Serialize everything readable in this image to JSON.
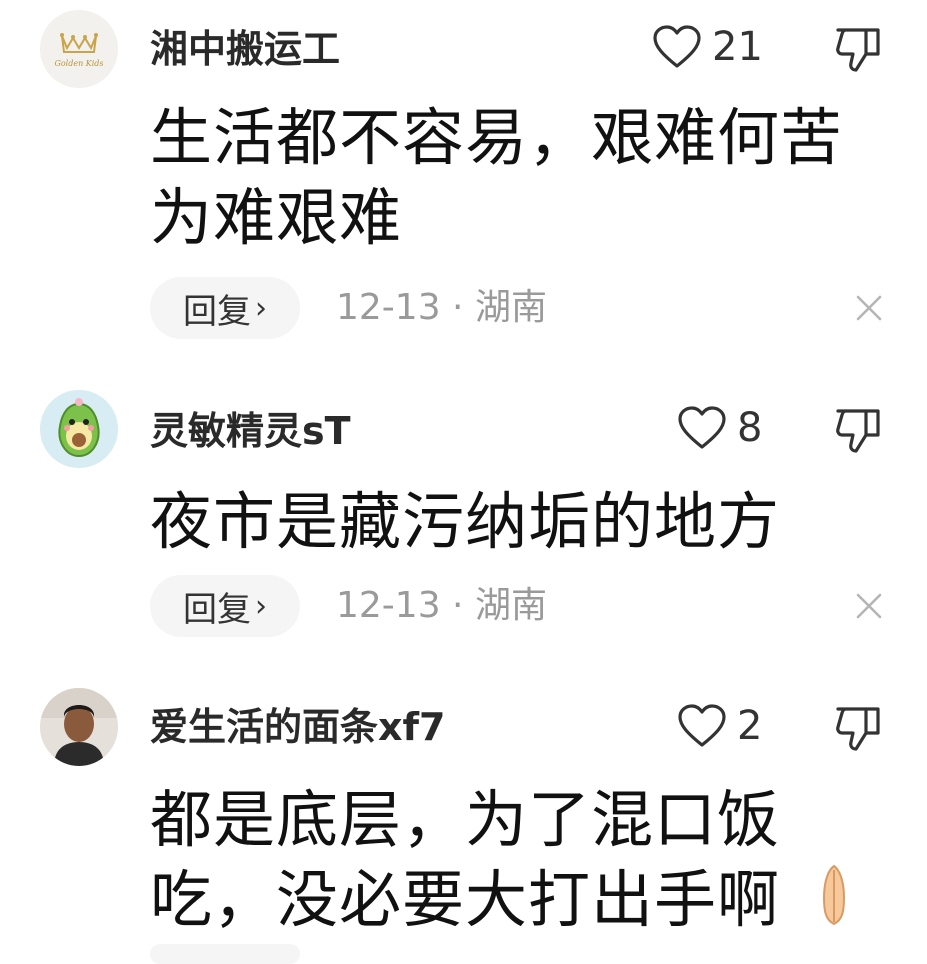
{
  "comments": [
    {
      "username": "湘中搬运工",
      "avatar": "goldenkids-crown-logo",
      "likes": "21",
      "text_lines": [
        "生活都不容易，艰难何苦",
        "为难艰难"
      ],
      "reply_label": "回复",
      "date": "12-13",
      "location": "湖南",
      "meta": "12-13 · 湖南"
    },
    {
      "username": "灵敏精灵sT",
      "avatar": "avocado-cartoon-avatar",
      "likes": "8",
      "text_lines": [
        "夜市是藏污纳垢的地方"
      ],
      "reply_label": "回复",
      "date": "12-13",
      "location": "湖南",
      "meta": "12-13 · 湖南"
    },
    {
      "username": "爱生活的面条xf7",
      "avatar": "person-photo-avatar",
      "likes": "2",
      "text_lines": [
        "都是底层，为了混口饭",
        "吃，没必要大打出手啊"
      ],
      "emoji": "folded-hands-emoji"
    }
  ],
  "avatar_logo_text": "Golden Kids",
  "icons": {
    "like": "heart-outline-icon",
    "dislike": "thumbs-down-outline-icon",
    "close": "close-x-icon",
    "chevron": "chevron-right-icon"
  },
  "colors": {
    "text": "#111111",
    "username": "#2a2a2a",
    "meta": "#9a9a9a",
    "reply_bg": "#f5f5f5"
  }
}
